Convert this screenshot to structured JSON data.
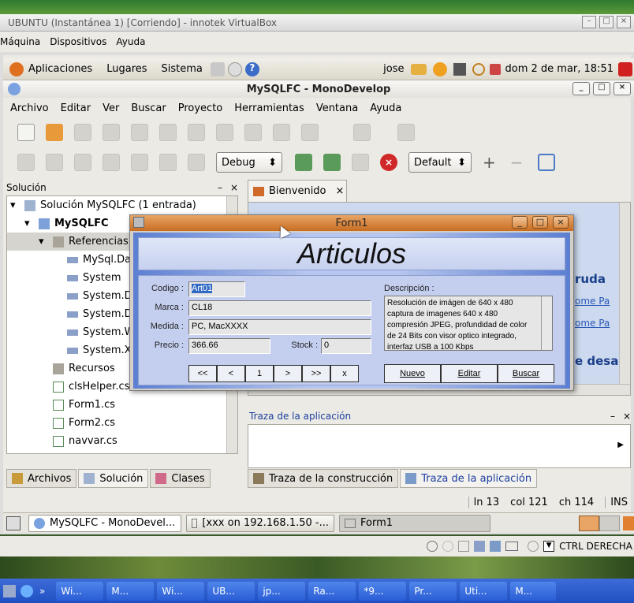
{
  "vbox": {
    "title": "UBUNTU (Instantánea 1) [Corriendo] - innotek VirtualBox",
    "menu": [
      "Máquina",
      "Dispositivos",
      "Ayuda"
    ],
    "status_right": "CTRL DERECHA"
  },
  "gnome": {
    "menu": [
      "Aplicaciones",
      "Lugares",
      "Sistema"
    ],
    "user": "jose",
    "clock": "dom  2 de mar, 18:51"
  },
  "monodevelop": {
    "title": "MySQLFC - MonoDevelop",
    "menu": [
      "Archivo",
      "Editar",
      "Ver",
      "Buscar",
      "Proyecto",
      "Herramientas",
      "Ventana",
      "Ayuda"
    ],
    "config_combo": "Debug",
    "platform_combo": "Default"
  },
  "solution": {
    "header": "Solución",
    "items": [
      {
        "label": "Solución MySQLFC (1 entrada)"
      },
      {
        "label": "MySQLFC"
      },
      {
        "label": "Referencias"
      },
      {
        "label": "MySql.Da"
      },
      {
        "label": "System"
      },
      {
        "label": "System.D"
      },
      {
        "label": "System.D"
      },
      {
        "label": "System.W"
      },
      {
        "label": "System.X"
      },
      {
        "label": "Recursos"
      },
      {
        "label": "clsHelper.cs"
      },
      {
        "label": "Form1.cs"
      },
      {
        "label": "Form2.cs"
      },
      {
        "label": "navvar.cs"
      }
    ],
    "bottom_tabs": [
      "Archivos",
      "Solución",
      "Clases"
    ]
  },
  "document": {
    "tab": "Bienvenido",
    "links": [
      "ruda",
      "ome Pa",
      "ome Pa",
      "e desa"
    ]
  },
  "trace": {
    "header": "Traza de la aplicación",
    "tabs": [
      "Traza de la construcción",
      "Traza de la aplicación"
    ]
  },
  "statusbar": {
    "ln": "ln 13",
    "col": "col 121",
    "ch": "ch 114",
    "mode": "INS"
  },
  "gnome_taskbar": [
    "MySQLFC - MonoDevel...",
    "[xxx on 192.168.1.50 -...",
    "Form1"
  ],
  "form1": {
    "title": "Form1",
    "heading": "Articulos",
    "labels": {
      "codigo": "Codigo :",
      "marca": "Marca :",
      "medida": "Medida :",
      "precio": "Precio :",
      "stock": "Stock :",
      "descripcion": "Descripción :"
    },
    "values": {
      "codigo": "Art01",
      "marca": "CL18",
      "medida": "PC, MacXXXX",
      "precio": "366.66",
      "stock": "0",
      "descripcion": "Resolución de imágen de 640 x 480 captura de imagenes 640 x 480 compresión JPEG, profundidad de color de 24 Bits con visor optico integrado, interfaz USB a 100 Kbps"
    },
    "nav": [
      "<<",
      "<",
      "1",
      ">",
      ">>",
      "x"
    ],
    "buttons": [
      "Nuevo",
      "Editar",
      "Buscar"
    ]
  },
  "windows_taskbar": [
    "Wi...",
    "M...",
    "Wi...",
    "UB...",
    "jp...",
    "Ra...",
    "*9...",
    "Pr...",
    "Uti...",
    "M..."
  ]
}
